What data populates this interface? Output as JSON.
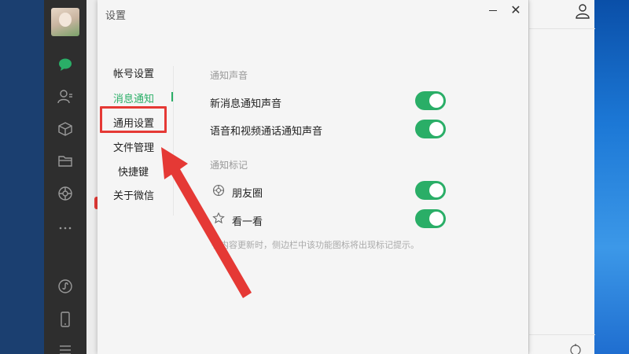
{
  "dialog": {
    "title": "设置",
    "close_symbol": "✕"
  },
  "nav": {
    "items": [
      {
        "label": "帐号设置",
        "active": false
      },
      {
        "label": "消息通知",
        "active": true
      },
      {
        "label": "通用设置",
        "active": false,
        "highlighted": true
      },
      {
        "label": "文件管理",
        "active": false
      },
      {
        "label": "快捷键",
        "active": false
      },
      {
        "label": "关于微信",
        "active": false
      }
    ]
  },
  "sound_section": {
    "title": "通知声音",
    "rows": [
      {
        "label": "新消息通知声音",
        "enabled": true
      },
      {
        "label": "语音和视频通话通知声音",
        "enabled": true
      }
    ]
  },
  "badge_section": {
    "title": "通知标记",
    "rows": [
      {
        "label": "朋友圈",
        "icon": "moments-icon",
        "enabled": true
      },
      {
        "label": "看一看",
        "icon": "look-icon",
        "enabled": true
      }
    ],
    "hint": "有内容更新时，侧边栏中该功能图标将出现标记提示。"
  },
  "sidebar": {
    "icons": [
      "chat-icon",
      "contacts-icon",
      "favorites-icon",
      "files-icon",
      "moments-icon",
      "more-icon",
      "miniprogram-icon",
      "phone-icon",
      "menu-icon"
    ]
  },
  "colors": {
    "accent": "#2aae67",
    "highlight": "#e53935",
    "sidebar_bg": "#2e2e2e"
  }
}
